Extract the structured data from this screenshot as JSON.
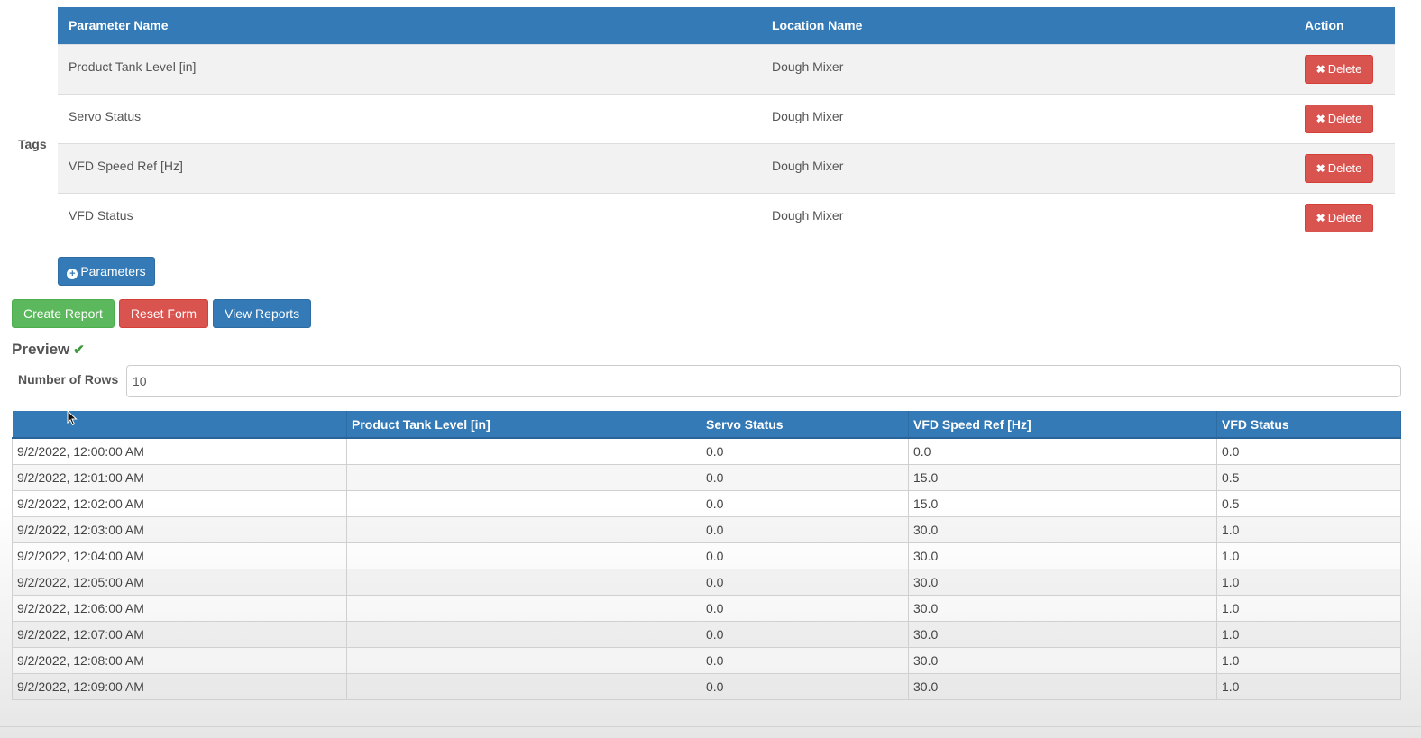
{
  "tags": {
    "label": "Tags",
    "columns": [
      "Parameter Name",
      "Location Name",
      "Action"
    ],
    "rows": [
      {
        "parameter": "Product Tank Level [in]",
        "location": "Dough Mixer",
        "action": "Delete"
      },
      {
        "parameter": "Servo Status",
        "location": "Dough Mixer",
        "action": "Delete"
      },
      {
        "parameter": "VFD Speed Ref [Hz]",
        "location": "Dough Mixer",
        "action": "Delete"
      },
      {
        "parameter": "VFD Status",
        "location": "Dough Mixer",
        "action": "Delete"
      }
    ],
    "add_button": "Parameters"
  },
  "actions": {
    "create": "Create Report",
    "reset": "Reset Form",
    "view": "View Reports"
  },
  "preview": {
    "title": "Preview",
    "rows_label": "Number of Rows",
    "rows_value": "10"
  },
  "results": {
    "columns": [
      "",
      "Product Tank Level [in]",
      "Servo Status",
      "VFD Speed Ref [Hz]",
      "VFD Status"
    ],
    "rows": [
      [
        "9/2/2022, 12:00:00 AM",
        "",
        "0.0",
        "0.0",
        "0.0"
      ],
      [
        "9/2/2022, 12:01:00 AM",
        "",
        "0.0",
        "15.0",
        "0.5"
      ],
      [
        "9/2/2022, 12:02:00 AM",
        "",
        "0.0",
        "15.0",
        "0.5"
      ],
      [
        "9/2/2022, 12:03:00 AM",
        "",
        "0.0",
        "30.0",
        "1.0"
      ],
      [
        "9/2/2022, 12:04:00 AM",
        "",
        "0.0",
        "30.0",
        "1.0"
      ],
      [
        "9/2/2022, 12:05:00 AM",
        "",
        "0.0",
        "30.0",
        "1.0"
      ],
      [
        "9/2/2022, 12:06:00 AM",
        "",
        "0.0",
        "30.0",
        "1.0"
      ],
      [
        "9/2/2022, 12:07:00 AM",
        "",
        "0.0",
        "30.0",
        "1.0"
      ],
      [
        "9/2/2022, 12:08:00 AM",
        "",
        "0.0",
        "30.0",
        "1.0"
      ],
      [
        "9/2/2022, 12:09:00 AM",
        "",
        "0.0",
        "30.0",
        "1.0"
      ]
    ]
  },
  "colors": {
    "primary": "#337ab7",
    "danger": "#d9534f",
    "success": "#5cb85c",
    "check": "#3c9a3c"
  },
  "icons": {
    "delete": "times-icon",
    "add": "plus-circle-icon",
    "preview_ok": "check-icon",
    "pointer": "mouse-cursor-icon"
  }
}
